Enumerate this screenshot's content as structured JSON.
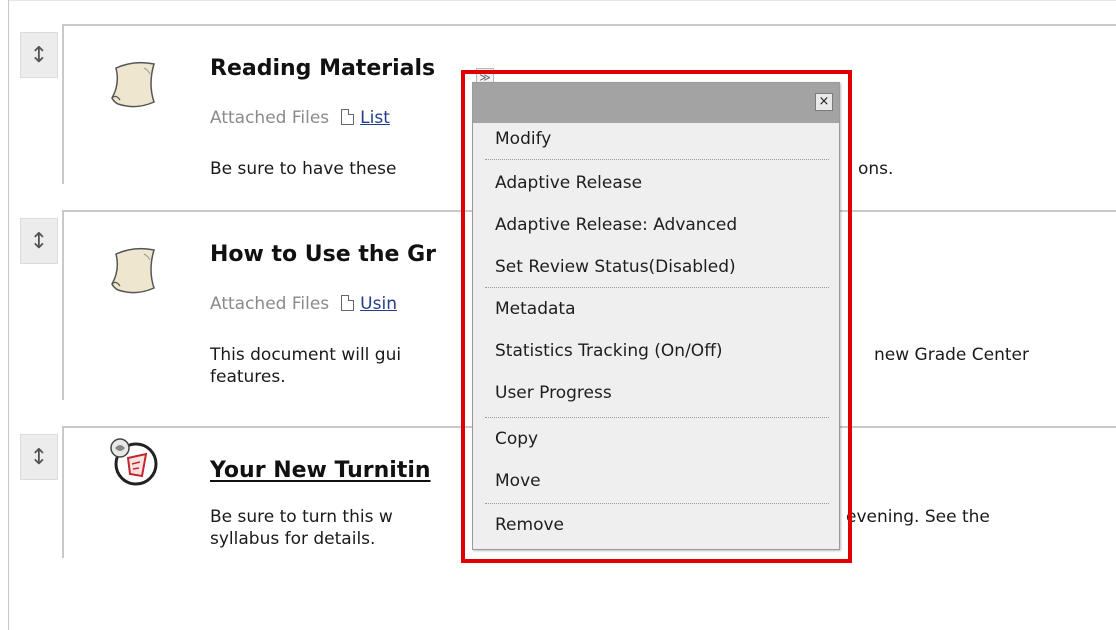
{
  "items": [
    {
      "title": "Reading Materials",
      "attached_label": "Attached Files",
      "file_link": "List",
      "description": "Be sure to have these",
      "description_right": "ons."
    },
    {
      "title": "How to Use the Gr",
      "attached_label": "Attached Files",
      "file_link": "Usin",
      "description_line1": "This document will gui",
      "description_line1_right": "new Grade Center",
      "description_line2": "features."
    },
    {
      "title": "Your New Turnitin",
      "description_line1": "Be sure to turn this w",
      "description_line1_right": "evening. See the",
      "description_line2": "syllabus for details."
    }
  ],
  "handle_glyph": "↕",
  "chevron_glyph": "≫",
  "menu": {
    "close_glyph": "×",
    "items": [
      "Modify",
      "Adaptive Release",
      "Adaptive Release: Advanced",
      "Set Review Status(Disabled)",
      "Metadata",
      "Statistics Tracking (On/Off)",
      "User Progress",
      "Copy",
      "Move",
      "Remove"
    ]
  },
  "colors": {
    "highlight_outline": "#e00000",
    "menu_header": "#a3a3a3",
    "menu_bg": "#efefef",
    "link": "#223c8a"
  }
}
